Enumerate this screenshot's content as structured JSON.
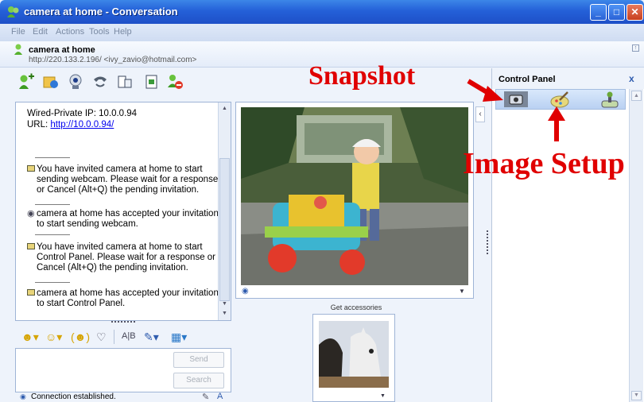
{
  "window": {
    "title": "camera at home - Conversation"
  },
  "menu": [
    "File",
    "Edit",
    "Actions",
    "Tools",
    "Help"
  ],
  "contact": {
    "name": "camera at home",
    "address": "http://220.133.2.196/ <ivy_zavio@hotmail.com>"
  },
  "toolbar_icons": [
    "invite-contact-icon",
    "send-files-icon",
    "webcam-icon",
    "phone-icon",
    "activities-icon",
    "games-icon",
    "block-icon"
  ],
  "chat": {
    "info_ip": "Wired-Private IP: 10.0.0.94",
    "info_url_label": "URL: ",
    "info_url": "http://10.0.0.94/",
    "msg1": "You have invited camera at home to start sending webcam. Please wait for a response or Cancel (Alt+Q) the pending invitation.",
    "msg2": "camera at home has accepted your invitation to start sending webcam.",
    "msg3": "You have invited camera at home to start Control Panel. Please wait for a response or Cancel (Alt+Q) the pending invitation.",
    "msg4": "camera at home has accepted your invitation to start Control Panel."
  },
  "compose": {
    "send_label": "Send",
    "search_label": "Search",
    "status": "Connection established."
  },
  "video": {
    "accessories_label": "Get accessories"
  },
  "control_panel": {
    "title": "Control Panel",
    "close": "x"
  },
  "annotations": {
    "snapshot": "Snapshot",
    "image_setup": "Image Setup"
  },
  "colors": {
    "titlebar": "#2460d8",
    "annotation": "#e00000",
    "link": "#0000ee"
  }
}
